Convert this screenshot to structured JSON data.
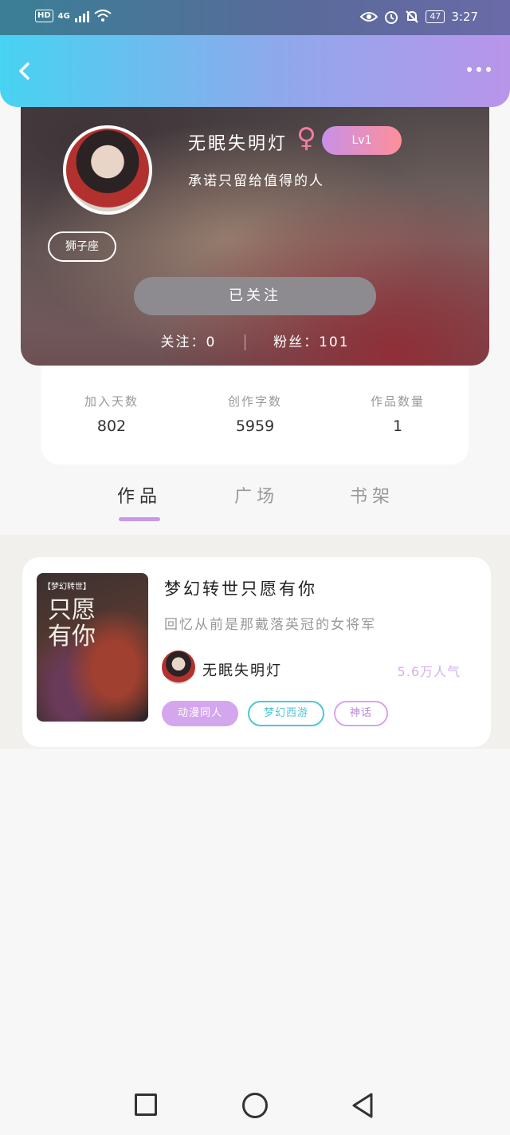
{
  "status_bar": {
    "hd": "HD",
    "network": "4G",
    "battery": "47",
    "time": "3:27",
    "icons": [
      "signal-icon",
      "wifi-icon",
      "eye-icon",
      "alarm-icon",
      "mute-bell-icon",
      "battery-icon"
    ]
  },
  "app_bar": {
    "back_icon": "chevron-left-icon",
    "more_icon": "more-dots-icon"
  },
  "profile": {
    "username": "无眠失明灯",
    "gender_symbol": "♀",
    "level": "Lv1",
    "signature": "承诺只留给值得的人",
    "zodiac": "狮子座",
    "follow_button": "已关注",
    "following_label": "关注：",
    "following_count": "0",
    "fans_label": "粉丝：",
    "fans_count": "101"
  },
  "stats": [
    {
      "label": "加入天数",
      "value": "802"
    },
    {
      "label": "创作字数",
      "value": "5959"
    },
    {
      "label": "作品数量",
      "value": "1"
    }
  ],
  "tabs": [
    {
      "label": "作品",
      "active": true
    },
    {
      "label": "广场",
      "active": false
    },
    {
      "label": "书架",
      "active": false
    }
  ],
  "work": {
    "cover_tag": "【梦幻转世】",
    "cover_title": "只愿有你",
    "title": "梦幻转世只愿有你",
    "description": "回忆从前是那戴落英冠的女将军",
    "author": "无眠失明灯",
    "popularity": "5.6万人气",
    "tags": [
      "动漫同人",
      "梦幻西游",
      "神话"
    ]
  },
  "colors": {
    "accent_purple": "#c79ae8",
    "teal_tag": "#4ec6d6",
    "appbar_start": "#47d3f2",
    "appbar_end": "#b995ea"
  }
}
